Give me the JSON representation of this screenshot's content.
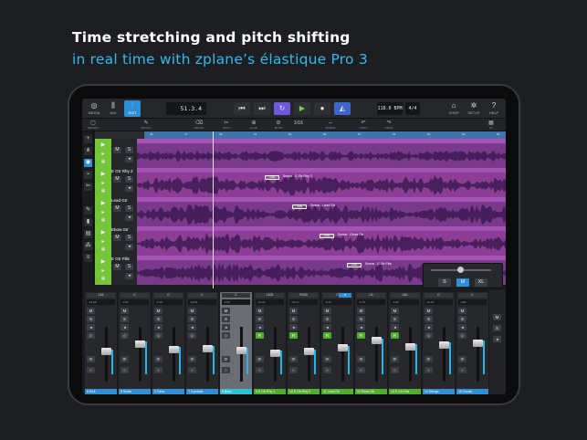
{
  "headline": {
    "title": "Time stretching and pitch shifting",
    "subtitle": "in real time with zplane’s élastique Pro 3"
  },
  "toolbar": {
    "media": "MEDIA",
    "mix": "MIX",
    "edit": "EDIT",
    "position": "51.3.4",
    "tempo": "118.0 BPM",
    "signature": "4/4",
    "shop": "SHOP",
    "setup": "SETUP",
    "help": "HELP"
  },
  "tools": {
    "select": "SELECT",
    "pencil": "PENCIL",
    "erase": "ERASE",
    "split": "SPLIT",
    "glue": "GLUE",
    "mute": "MUTE",
    "range": "RANGE",
    "quantize": "1/16",
    "undo": "UNDO",
    "redo": "REDO",
    "fx": "FX"
  },
  "ruler": [
    "45",
    "47",
    "49",
    "51",
    "53",
    "55",
    "57",
    "59",
    "61",
    "63",
    "65"
  ],
  "tracks": [
    {
      "num": "",
      "name": "",
      "clip_label": "",
      "warp": ""
    },
    {
      "num": "6",
      "name": "E Gtr Rhy 2",
      "clip_label": "Smear - E Gtr Rhy 2",
      "warp": "4.06"
    },
    {
      "num": "11",
      "name": "Lead Gtr",
      "clip_label": "Smear - Lead Gtr",
      "warp": "4.06"
    },
    {
      "num": "",
      "name": "Ebow Gtr",
      "clip_label": "Smear - Ebow Gtr",
      "warp": "4.06"
    },
    {
      "num": "",
      "name": "E Gtr Fills",
      "clip_label": "Smear - E Gtr Fills",
      "warp": "4.06"
    }
  ],
  "zoom": {
    "sizes": [
      "S",
      "M",
      "XL"
    ],
    "selected": "M"
  },
  "mixer": {
    "strips": [
      {
        "route": "L16",
        "chip": "",
        "pan": "-13.90",
        "name": "6 Kick",
        "level": 0.55,
        "color": "#2f8fd6"
      },
      {
        "route": "C",
        "chip": "",
        "pan": "-2.51",
        "name": "5 Snare",
        "level": 0.72,
        "color": "#2f8fd6"
      },
      {
        "route": "C",
        "chip": "",
        "pan": "-6.19",
        "name": "4 Toms",
        "level": 0.6,
        "color": "#2f8fd6"
      },
      {
        "route": "C",
        "chip": "",
        "pan": "-12.81",
        "name": "7 Cymbals",
        "level": 0.62,
        "color": "#2f8fd6"
      },
      {
        "route": "C",
        "chip": "",
        "pan": "-2.51",
        "name": "8 Bass",
        "level": 0.58,
        "color": "#2fbfd6",
        "selected": true
      },
      {
        "route": "L100",
        "chip": "",
        "pan": "-10.01",
        "name": "9 E Gtr Rhy 1",
        "level": 0.52,
        "color": "#4fae2b"
      },
      {
        "route": "R100",
        "chip": "",
        "pan": "-15.17",
        "name": "10 E Gtr Rhy 2",
        "level": 0.55,
        "color": "#4fae2b"
      },
      {
        "route": "C",
        "chip": "R",
        "pan": "-6.21",
        "name": "11 Lead Gtr",
        "level": 0.63,
        "color": "#4fae2b"
      },
      {
        "route": "L5",
        "chip": "",
        "pan": "-6.75",
        "name": "12 Ebow Gtr",
        "level": 0.78,
        "color": "#4fae2b"
      },
      {
        "route": "L60",
        "chip": "",
        "pan": "-5.62",
        "name": "13 E Gtr Fills",
        "level": 0.66,
        "color": "#4fae2b"
      },
      {
        "route": "C",
        "chip": "",
        "pan": "-11.15",
        "name": "14 Strings",
        "level": 0.7,
        "color": "#2f8fd6"
      },
      {
        "route": "C",
        "chip": "",
        "pan": "-3.81",
        "name": "15 Vocals",
        "level": 0.74,
        "color": "#2f8fd6"
      }
    ]
  }
}
